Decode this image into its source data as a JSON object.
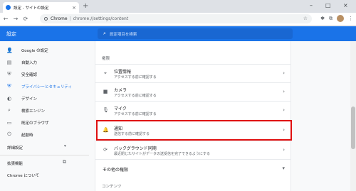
{
  "browser": {
    "tab_title": "設定 - サイトの設定",
    "tab_close": "×",
    "new_tab": "+",
    "window_controls": [
      "–",
      "□",
      "×"
    ],
    "nav": {
      "back": "←",
      "forward": "→",
      "reload": "⟳"
    },
    "address": {
      "site": "Chrome",
      "separator": "|",
      "url": "chrome://settings/content"
    },
    "star": "☆"
  },
  "settings": {
    "title": "設定",
    "search_placeholder": "設定項目を検索"
  },
  "sidebar": {
    "items": [
      {
        "label": "Google の設定",
        "icon": "👤"
      },
      {
        "label": "自動入力",
        "icon": "▤"
      },
      {
        "label": "安全確認",
        "icon": "⛨"
      },
      {
        "label": "プライバシーとセキュリティ",
        "icon": "⛨",
        "active": true
      },
      {
        "label": "デザイン",
        "icon": "◐"
      },
      {
        "label": "検索エンジン",
        "icon": "⌕"
      },
      {
        "label": "既定のブラウザ",
        "icon": "▭"
      },
      {
        "label": "起動時",
        "icon": "⏻"
      }
    ],
    "advanced": "詳細設定",
    "advanced_arrow": "▾",
    "extensions": "拡張機能",
    "extensions_icon": "⧉",
    "about": "Chrome について"
  },
  "main": {
    "permissions_label": "権限",
    "rows": [
      {
        "title": "位置情報",
        "subtitle": "アクセスする前に確認する",
        "icon": "⌖"
      },
      {
        "title": "カメラ",
        "subtitle": "アクセスする前に確認する",
        "icon": "■"
      },
      {
        "title": "マイク",
        "subtitle": "アクセスする前に確認する",
        "icon": "🎙"
      },
      {
        "title": "通知",
        "subtitle": "送信する前に確認する",
        "icon": "🔔"
      },
      {
        "title": "バックグラウンド同期",
        "subtitle": "最近閉じたサイトがデータの送受信を完了できるようにする",
        "icon": "⟳"
      }
    ],
    "other_permissions": "その他の権限",
    "content_label": "コンテンツ",
    "chevron": "›",
    "chevron_down": "▾"
  },
  "colors": {
    "accent": "#1a73e8",
    "highlight": "#e01010"
  }
}
